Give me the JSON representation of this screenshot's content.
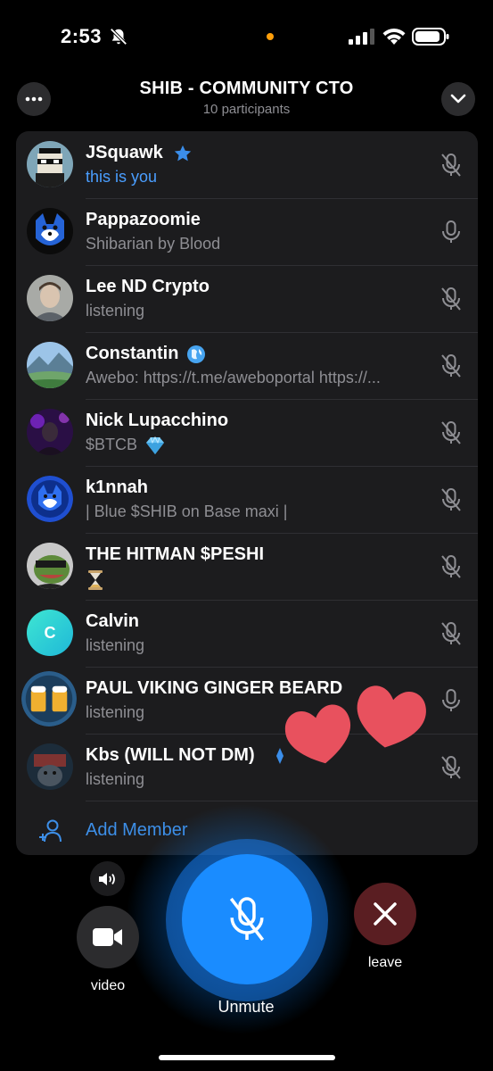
{
  "status_bar": {
    "time": "2:53",
    "icons": [
      "bell-slash-icon",
      "recording-dot-icon",
      "cellular-signal-icon",
      "wifi-icon",
      "battery-icon"
    ]
  },
  "header": {
    "title": "SHIB - COMMUNITY CTO",
    "subtitle": "10 participants",
    "left_icon": "more-dots-icon",
    "right_icon": "chevron-down-icon"
  },
  "participants": [
    {
      "name": "JSquawk",
      "badge": "star-icon",
      "sub": "this is you",
      "is_you": true,
      "mic": "muted"
    },
    {
      "name": "Pappazoomie",
      "sub": "Shibarian by Blood",
      "mic": "active"
    },
    {
      "name": "Lee ND Crypto",
      "sub": "listening",
      "mic": "muted"
    },
    {
      "name": "Constantin",
      "badge": "globe-emoji",
      "sub": "Awebo: https://t.me/aweboportal https://...",
      "mic": "muted"
    },
    {
      "name": "Nick Lupacchino",
      "sub": "$BTCB",
      "sub_emoji": "gem-emoji",
      "mic": "muted"
    },
    {
      "name": "k1nnah",
      "sub": "| Blue $SHIB on Base maxi |",
      "mic": "muted"
    },
    {
      "name": "THE HITMAN $PESHI",
      "sub_emoji": "hourglass-emoji",
      "mic": "muted"
    },
    {
      "name": "Calvin",
      "avatar_letter": "C",
      "sub": "listening",
      "mic": "muted"
    },
    {
      "name": "PAUL VIKING GINGER BEARD",
      "sub": "listening",
      "mic": "active"
    },
    {
      "name": "Kbs (WILL NOT DM)",
      "badge": "blue-diamond-emoji",
      "sub": "listening",
      "mic": "muted"
    }
  ],
  "add_member": {
    "label": "Add Member",
    "icon": "add-person-icon"
  },
  "controls": {
    "speaker_icon": "speaker-icon",
    "video_label": "video",
    "unmute_label": "Unmute",
    "leave_label": "leave"
  },
  "colors": {
    "accent_blue": "#1a8cff",
    "you_text": "#4a9eff",
    "leave_bg": "#5a1e22",
    "panel_bg": "#1c1c1e",
    "heart": "#e8515e"
  }
}
